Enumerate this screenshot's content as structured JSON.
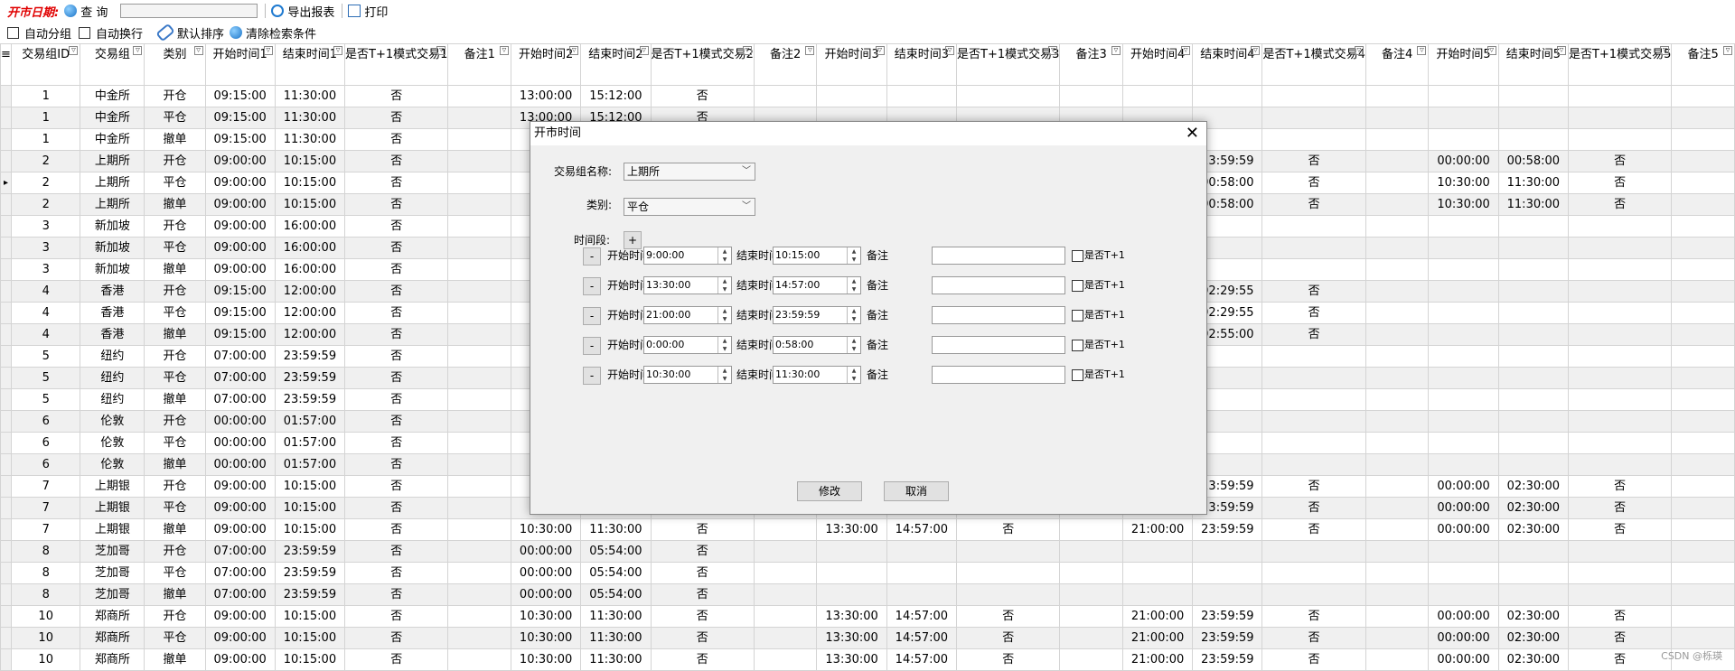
{
  "toolbar": {
    "title": "开市日期:",
    "query_label": "查 询",
    "export_label": "导出报表",
    "print_label": "打印"
  },
  "options": {
    "auto_group": "自动分组",
    "auto_wrap": "自动换行",
    "default_sort": "默认排序",
    "clear_filter": "清除检索条件"
  },
  "columns": [
    "交易组ID",
    "交易组",
    "类别",
    "开始时间1",
    "结束时间1",
    "是否T+1模式交易1",
    "备注1",
    "开始时间2",
    "结束时间2",
    "是否T+1模式交易2",
    "备注2",
    "开始时间3",
    "结束时间3",
    "是否T+1模式交易3",
    "备注3",
    "开始时间4",
    "结束时间4",
    "是否T+1模式交易4",
    "备注4",
    "开始时间5",
    "结束时间5",
    "是否T+1模式交易5",
    "备注5"
  ],
  "rows": [
    [
      "1",
      "中金所",
      "开仓",
      "09:15:00",
      "11:30:00",
      "否",
      "",
      "13:00:00",
      "15:12:00",
      "否",
      "",
      "",
      "",
      "",
      "",
      "",
      "",
      "",
      "",
      "",
      "",
      "",
      ""
    ],
    [
      "1",
      "中金所",
      "平仓",
      "09:15:00",
      "11:30:00",
      "否",
      "",
      "13:00:00",
      "15:12:00",
      "否",
      "",
      "",
      "",
      "",
      "",
      "",
      "",
      "",
      "",
      "",
      "",
      "",
      ""
    ],
    [
      "1",
      "中金所",
      "撤单",
      "09:15:00",
      "11:30:00",
      "否",
      "",
      "",
      "",
      "",
      "",
      "",
      "",
      "",
      "",
      "",
      "",
      "",
      "",
      "",
      "",
      "",
      ""
    ],
    [
      "2",
      "上期所",
      "开仓",
      "09:00:00",
      "10:15:00",
      "否",
      "",
      "",
      "",
      "",
      "",
      "",
      "",
      "",
      "",
      "",
      "23:59:59",
      "否",
      "",
      "00:00:00",
      "00:58:00",
      "否",
      ""
    ],
    [
      "2",
      "上期所",
      "平仓",
      "09:00:00",
      "10:15:00",
      "否",
      "",
      "",
      "",
      "",
      "",
      "",
      "",
      "",
      "",
      "",
      "00:58:00",
      "否",
      "",
      "10:30:00",
      "11:30:00",
      "否",
      ""
    ],
    [
      "2",
      "上期所",
      "撤单",
      "09:00:00",
      "10:15:00",
      "否",
      "",
      "",
      "",
      "",
      "",
      "",
      "",
      "",
      "",
      "",
      "00:58:00",
      "否",
      "",
      "10:30:00",
      "11:30:00",
      "否",
      ""
    ],
    [
      "3",
      "新加坡",
      "开仓",
      "09:00:00",
      "16:00:00",
      "否",
      "",
      "",
      "",
      "",
      "",
      "",
      "",
      "",
      "",
      "",
      "",
      "",
      "",
      "",
      "",
      "",
      ""
    ],
    [
      "3",
      "新加坡",
      "平仓",
      "09:00:00",
      "16:00:00",
      "否",
      "",
      "",
      "",
      "",
      "",
      "",
      "",
      "",
      "",
      "",
      "",
      "",
      "",
      "",
      "",
      "",
      ""
    ],
    [
      "3",
      "新加坡",
      "撤单",
      "09:00:00",
      "16:00:00",
      "否",
      "",
      "",
      "",
      "",
      "",
      "",
      "",
      "",
      "",
      "",
      "",
      "",
      "",
      "",
      "",
      "",
      ""
    ],
    [
      "4",
      "香港",
      "开仓",
      "09:15:00",
      "12:00:00",
      "否",
      "",
      "",
      "",
      "",
      "",
      "",
      "",
      "",
      "",
      "",
      "02:29:55",
      "否",
      "",
      "",
      "",
      "",
      ""
    ],
    [
      "4",
      "香港",
      "平仓",
      "09:15:00",
      "12:00:00",
      "否",
      "",
      "",
      "",
      "",
      "",
      "",
      "",
      "",
      "",
      "",
      "02:29:55",
      "否",
      "",
      "",
      "",
      "",
      ""
    ],
    [
      "4",
      "香港",
      "撤单",
      "09:15:00",
      "12:00:00",
      "否",
      "",
      "",
      "",
      "",
      "",
      "",
      "",
      "",
      "",
      "",
      "02:55:00",
      "否",
      "",
      "",
      "",
      "",
      ""
    ],
    [
      "5",
      "纽约",
      "开仓",
      "07:00:00",
      "23:59:59",
      "否",
      "",
      "",
      "",
      "",
      "",
      "",
      "",
      "",
      "",
      "",
      "",
      "",
      "",
      "",
      "",
      "",
      ""
    ],
    [
      "5",
      "纽约",
      "平仓",
      "07:00:00",
      "23:59:59",
      "否",
      "",
      "",
      "",
      "",
      "",
      "",
      "",
      "",
      "",
      "",
      "",
      "",
      "",
      "",
      "",
      "",
      ""
    ],
    [
      "5",
      "纽约",
      "撤单",
      "07:00:00",
      "23:59:59",
      "否",
      "",
      "",
      "",
      "",
      "",
      "",
      "",
      "",
      "",
      "",
      "",
      "",
      "",
      "",
      "",
      "",
      ""
    ],
    [
      "6",
      "伦敦",
      "开仓",
      "00:00:00",
      "01:57:00",
      "否",
      "",
      "",
      "",
      "",
      "",
      "",
      "",
      "",
      "",
      "",
      "",
      "",
      "",
      "",
      "",
      "",
      ""
    ],
    [
      "6",
      "伦敦",
      "平仓",
      "00:00:00",
      "01:57:00",
      "否",
      "",
      "",
      "",
      "",
      "",
      "",
      "",
      "",
      "",
      "",
      "",
      "",
      "",
      "",
      "",
      "",
      ""
    ],
    [
      "6",
      "伦敦",
      "撤单",
      "00:00:00",
      "01:57:00",
      "否",
      "",
      "",
      "",
      "",
      "",
      "",
      "",
      "",
      "",
      "",
      "",
      "",
      "",
      "",
      "",
      "",
      ""
    ],
    [
      "7",
      "上期银",
      "开仓",
      "09:00:00",
      "10:15:00",
      "否",
      "",
      "",
      "",
      "",
      "",
      "",
      "",
      "",
      "",
      "",
      "23:59:59",
      "否",
      "",
      "00:00:00",
      "02:30:00",
      "否",
      ""
    ],
    [
      "7",
      "上期银",
      "平仓",
      "09:00:00",
      "10:15:00",
      "否",
      "",
      "",
      "",
      "",
      "",
      "",
      "",
      "",
      "",
      "",
      "23:59:59",
      "否",
      "",
      "00:00:00",
      "02:30:00",
      "否",
      ""
    ],
    [
      "7",
      "上期银",
      "撤单",
      "09:00:00",
      "10:15:00",
      "否",
      "",
      "10:30:00",
      "11:30:00",
      "否",
      "",
      "13:30:00",
      "14:57:00",
      "否",
      "",
      "21:00:00",
      "23:59:59",
      "否",
      "",
      "00:00:00",
      "02:30:00",
      "否",
      ""
    ],
    [
      "8",
      "芝加哥",
      "开仓",
      "07:00:00",
      "23:59:59",
      "否",
      "",
      "00:00:00",
      "05:54:00",
      "否",
      "",
      "",
      "",
      "",
      "",
      "",
      "",
      "",
      "",
      "",
      "",
      "",
      ""
    ],
    [
      "8",
      "芝加哥",
      "平仓",
      "07:00:00",
      "23:59:59",
      "否",
      "",
      "00:00:00",
      "05:54:00",
      "否",
      "",
      "",
      "",
      "",
      "",
      "",
      "",
      "",
      "",
      "",
      "",
      "",
      ""
    ],
    [
      "8",
      "芝加哥",
      "撤单",
      "07:00:00",
      "23:59:59",
      "否",
      "",
      "00:00:00",
      "05:54:00",
      "否",
      "",
      "",
      "",
      "",
      "",
      "",
      "",
      "",
      "",
      "",
      "",
      "",
      ""
    ],
    [
      "10",
      "郑商所",
      "开仓",
      "09:00:00",
      "10:15:00",
      "否",
      "",
      "10:30:00",
      "11:30:00",
      "否",
      "",
      "13:30:00",
      "14:57:00",
      "否",
      "",
      "21:00:00",
      "23:59:59",
      "否",
      "",
      "00:00:00",
      "02:30:00",
      "否",
      ""
    ],
    [
      "10",
      "郑商所",
      "平仓",
      "09:00:00",
      "10:15:00",
      "否",
      "",
      "10:30:00",
      "11:30:00",
      "否",
      "",
      "13:30:00",
      "14:57:00",
      "否",
      "",
      "21:00:00",
      "23:59:59",
      "否",
      "",
      "00:00:00",
      "02:30:00",
      "否",
      ""
    ],
    [
      "10",
      "郑商所",
      "撤单",
      "09:00:00",
      "10:15:00",
      "否",
      "",
      "10:30:00",
      "11:30:00",
      "否",
      "",
      "13:30:00",
      "14:57:00",
      "否",
      "",
      "21:00:00",
      "23:59:59",
      "否",
      "",
      "00:00:00",
      "02:30:00",
      "否",
      ""
    ]
  ],
  "dialog": {
    "title": "开市时间",
    "group_label": "交易组名称:",
    "group_value": "上期所",
    "type_label": "类别:",
    "type_value": "平仓",
    "period_label": "时间段:",
    "add_label": "+",
    "remove_label": "-",
    "start_label": "开始时间",
    "end_label": "结束时间",
    "note_label": "备注",
    "t1_label": "是否T+1",
    "periods": [
      {
        "start": "9:00:00",
        "end": "10:15:00"
      },
      {
        "start": "13:30:00",
        "end": "14:57:00"
      },
      {
        "start": "21:00:00",
        "end": "23:59:59"
      },
      {
        "start": "0:00:00",
        "end": "0:58:00"
      },
      {
        "start": "10:30:00",
        "end": "11:30:00"
      }
    ],
    "modify_label": "修改",
    "cancel_label": "取消"
  },
  "watermark": "CSDN @栎瑛"
}
